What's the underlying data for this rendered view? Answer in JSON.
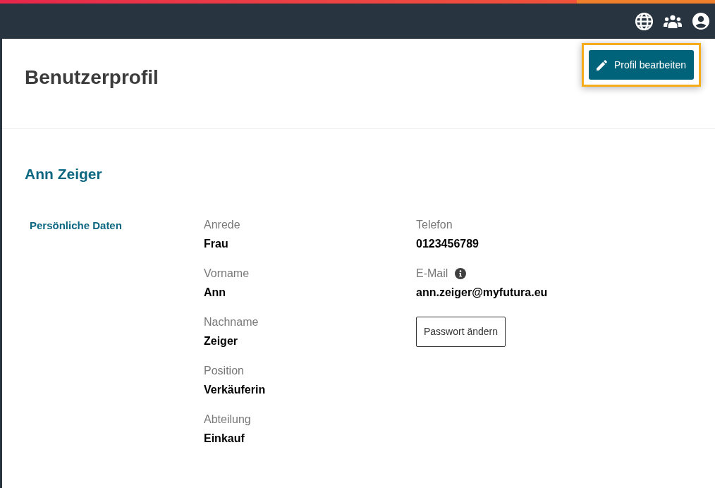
{
  "page_header": {
    "title": "Benutzerprofil",
    "edit_button": {
      "label": "Profil bearbeiten",
      "focused": true
    }
  },
  "profile": {
    "name": "Ann Zeiger",
    "section_title": "Persönliche Daten",
    "columns": [
      [
        {
          "label": "Anrede",
          "value": "Frau",
          "info": false
        },
        {
          "label": "Vorname",
          "value": "Ann",
          "info": false
        },
        {
          "label": "Nachname",
          "value": "Zeiger",
          "info": false
        },
        {
          "label": "Position",
          "value": "Verkäuferin",
          "info": false
        },
        {
          "label": "Abteilung",
          "value": "Einkauf",
          "info": false
        }
      ],
      [
        {
          "label": "Telefon",
          "value": "0123456789",
          "info": false
        },
        {
          "label": "E-Mail",
          "value": "ann.zeiger@myfutura.eu",
          "info": true
        }
      ]
    ],
    "password_button": {
      "label": "Passwort ändern"
    }
  }
}
